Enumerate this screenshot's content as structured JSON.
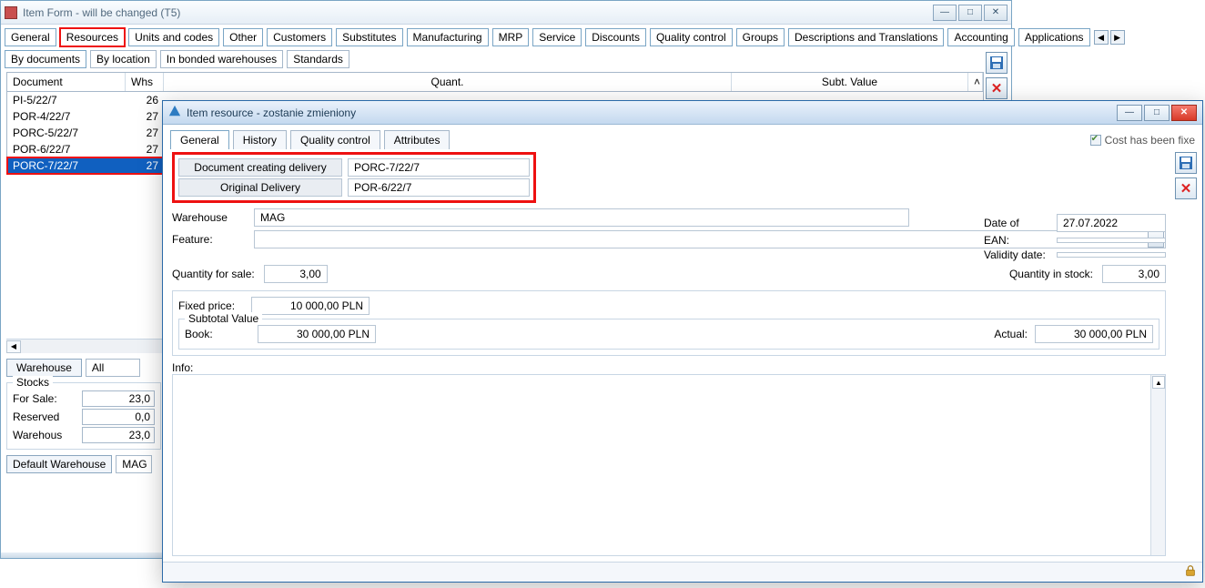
{
  "main": {
    "title": "Item Form - will be changed (T5)",
    "tabs1": [
      "General",
      "Resources",
      "Units and codes",
      "Other",
      "Customers",
      "Substitutes",
      "Manufacturing",
      "MRP",
      "Service",
      "Discounts",
      "Quality control",
      "Groups",
      "Descriptions and Translations",
      "Accounting",
      "Applications"
    ],
    "tabs1_active": 1,
    "tabs2": [
      "By documents",
      "By location",
      "In bonded warehouses",
      "Standards"
    ],
    "tabs2_active": 0,
    "grid": {
      "headers": {
        "doc": "Document",
        "whs": "Whs",
        "quant": "Quant.",
        "subt": "Subt. Value"
      },
      "rows": [
        {
          "doc": "PI-5/22/7",
          "whs": "26"
        },
        {
          "doc": "POR-4/22/7",
          "whs": "27"
        },
        {
          "doc": "PORC-5/22/7",
          "whs": "27"
        },
        {
          "doc": "POR-6/22/7",
          "whs": "27"
        },
        {
          "doc": "PORC-7/22/7",
          "whs": "27"
        }
      ],
      "selected": 4
    },
    "filter": {
      "warehouse_btn": "Warehouse",
      "all_value": "All"
    },
    "stocks": {
      "legend": "Stocks",
      "for_sale_lbl": "For Sale:",
      "for_sale_val": "23,0",
      "reserved_lbl": "Reserved",
      "reserved_val": "0,0",
      "warehouse_lbl": "Warehous",
      "warehouse_val": "23,0"
    },
    "defwh": {
      "btn": "Default Warehouse",
      "val": "MAG"
    }
  },
  "modal": {
    "title": "Item resource - zostanie zmieniony",
    "tabs": [
      "General",
      "History",
      "Quality control",
      "Attributes"
    ],
    "tabs_active": 0,
    "cost_fixed_lbl": "Cost has been fixe",
    "doc_delivery": {
      "lbl": "Document creating delivery",
      "val": "PORC-7/22/7"
    },
    "orig_delivery": {
      "lbl": "Original Delivery",
      "val": "POR-6/22/7"
    },
    "warehouse": {
      "lbl": "Warehouse",
      "val": "MAG"
    },
    "feature_lbl": "Feature:",
    "date_of": {
      "lbl": "Date of",
      "val": "27.07.2022"
    },
    "ean_lbl": "EAN:",
    "validity_lbl": "Validity date:",
    "qty_sale": {
      "lbl": "Quantity for sale:",
      "val": "3,00"
    },
    "qty_stock": {
      "lbl": "Quantity in stock:",
      "val": "3,00"
    },
    "fixed_price": {
      "lbl": "Fixed price:",
      "val": "10 000,00 PLN"
    },
    "subtotal_legend": "Subtotal Value",
    "book": {
      "lbl": "Book:",
      "val": "30 000,00 PLN"
    },
    "actual": {
      "lbl": "Actual:",
      "val": "30 000,00 PLN"
    },
    "info_lbl": "Info:"
  }
}
